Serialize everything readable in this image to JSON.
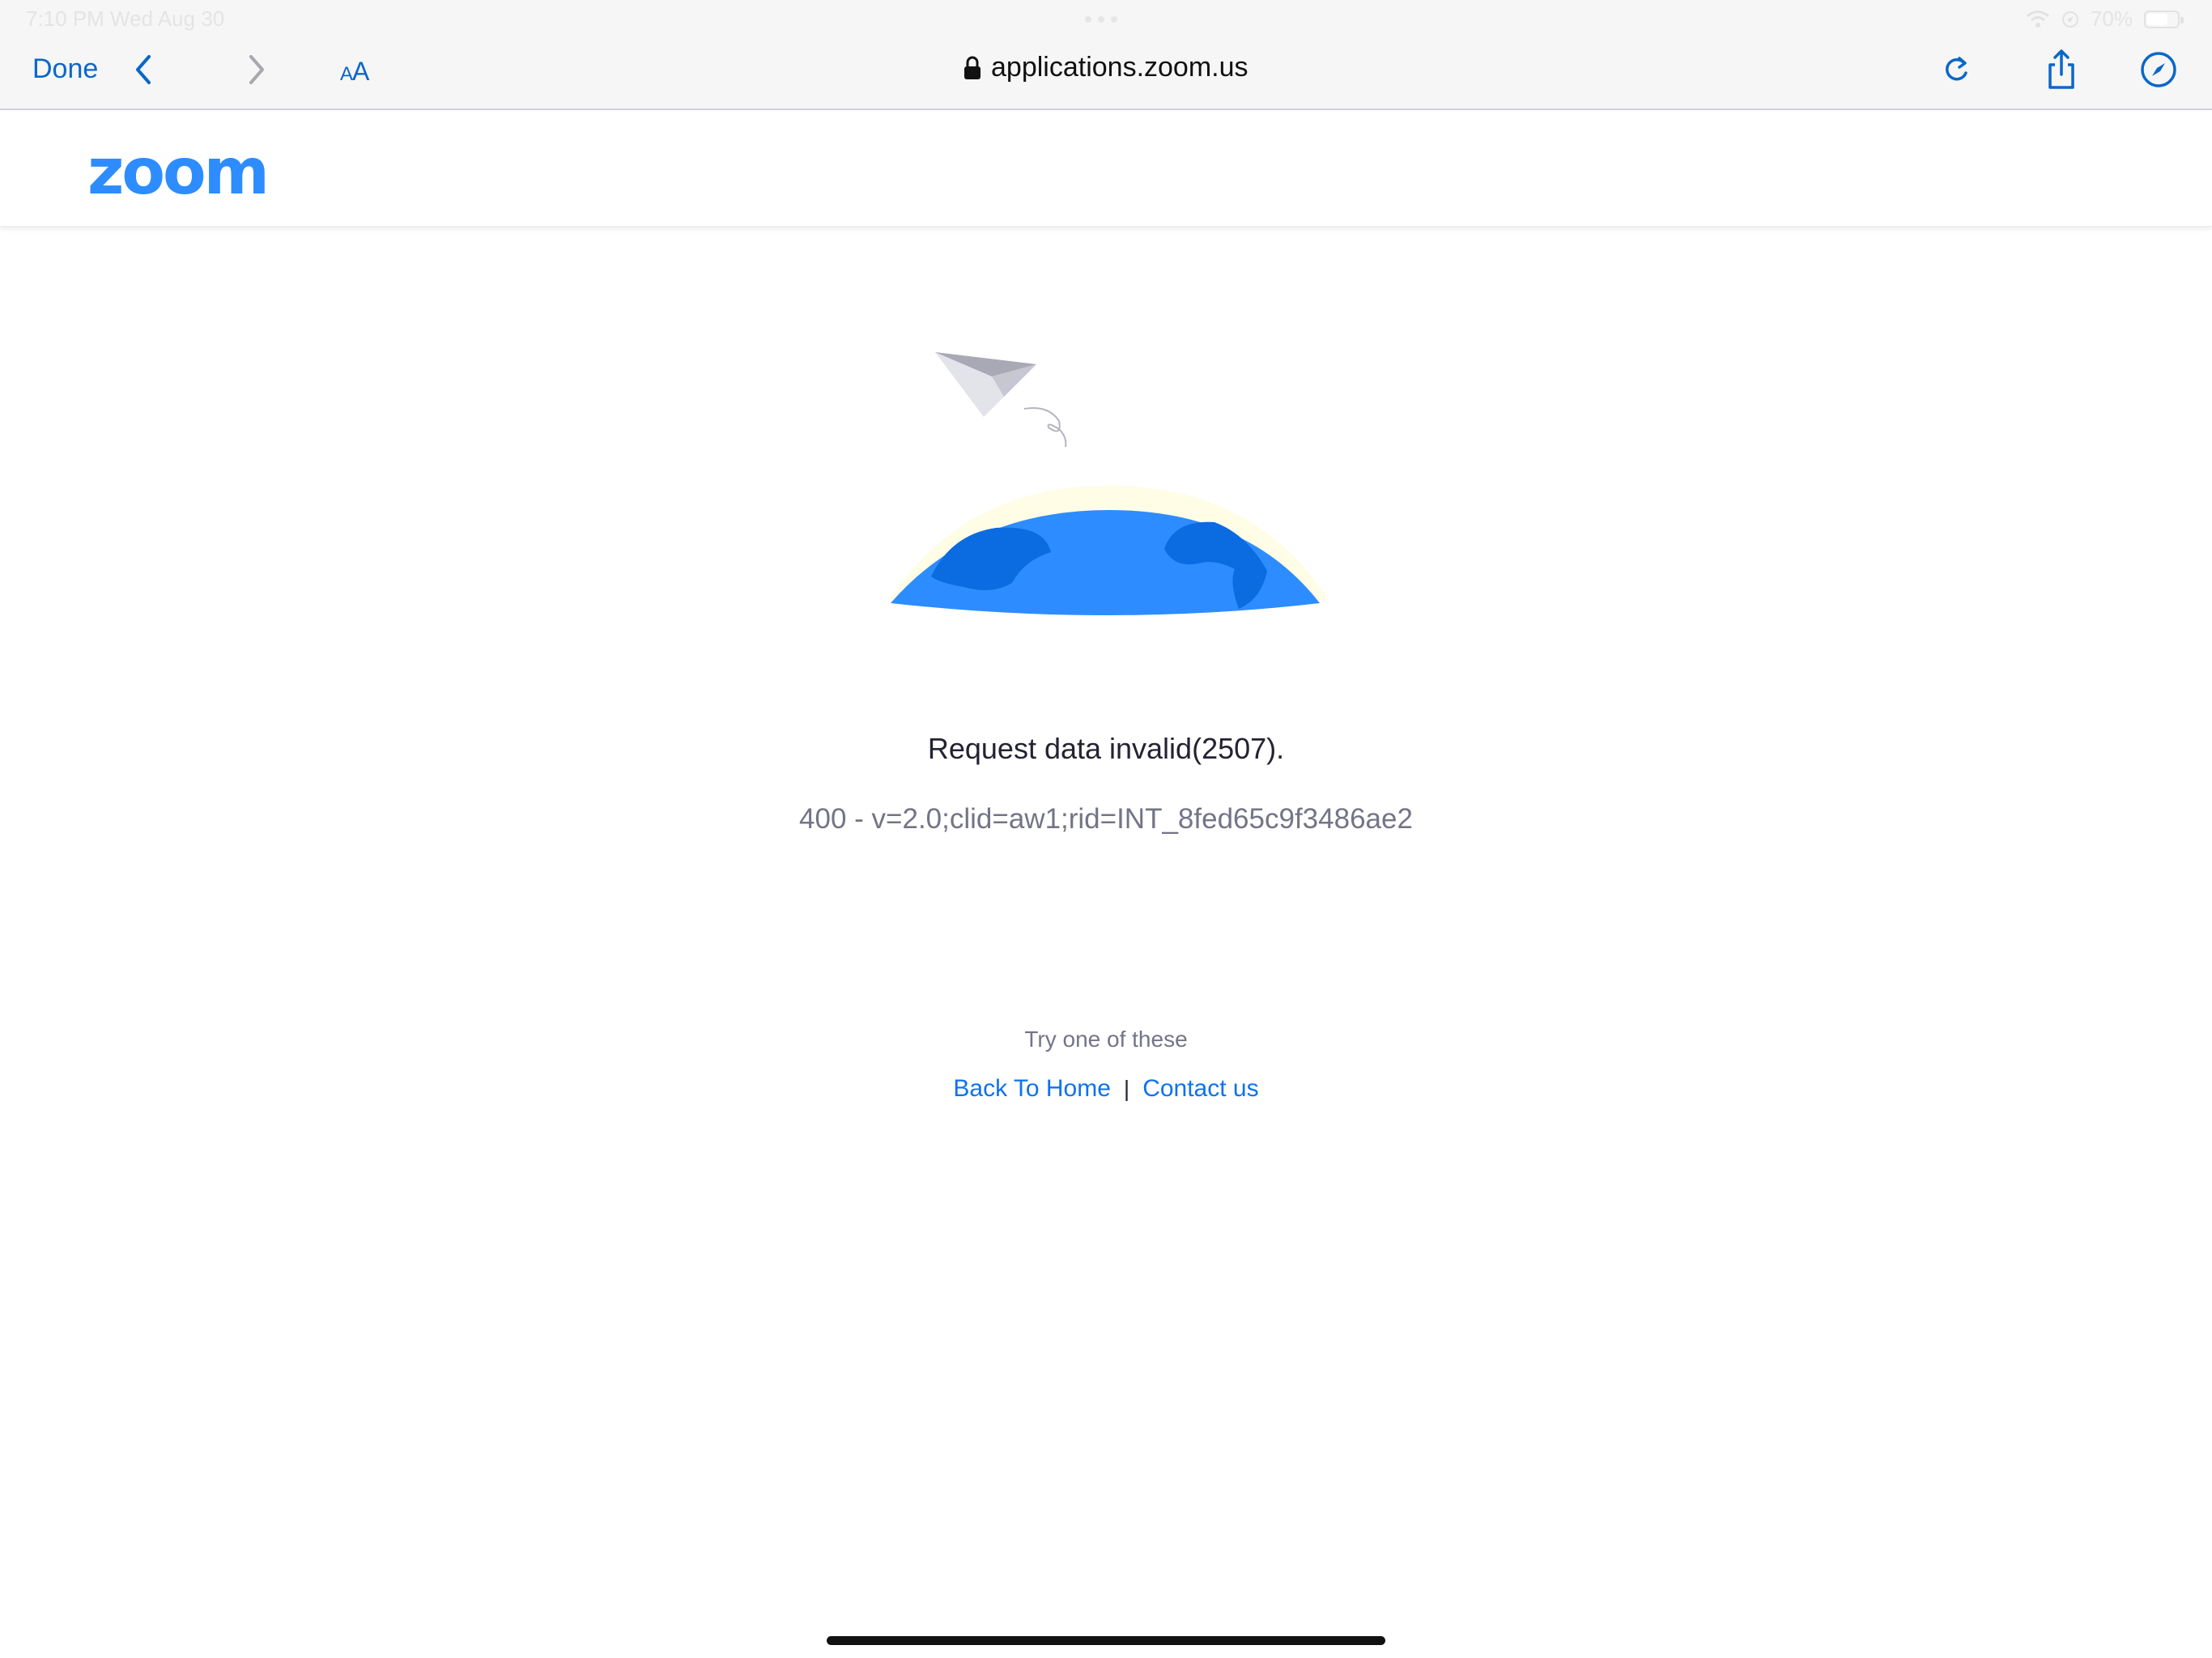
{
  "status_bar": {
    "time": "7:10 PM   Wed Aug 30",
    "battery": "70%"
  },
  "toolbar": {
    "done_label": "Done",
    "text_size_small": "A",
    "text_size_large": "A",
    "url": "applications.zoom.us"
  },
  "header": {
    "logo_text": "zoom"
  },
  "error": {
    "title": "Request data invalid(2507).",
    "detail": "400 - v=2.0;clid=aw1;rid=INT_8fed65c9f3486ae2"
  },
  "suggestions": {
    "prompt": "Try one of these",
    "back_home": "Back To Home",
    "separator": "|",
    "contact": "Contact us"
  },
  "colors": {
    "accent": "#0a67c9",
    "zoom_blue": "#2d8cff",
    "link_blue": "#0e72ed",
    "globe": "#2d8cff",
    "globe_land": "#0b6be0"
  }
}
